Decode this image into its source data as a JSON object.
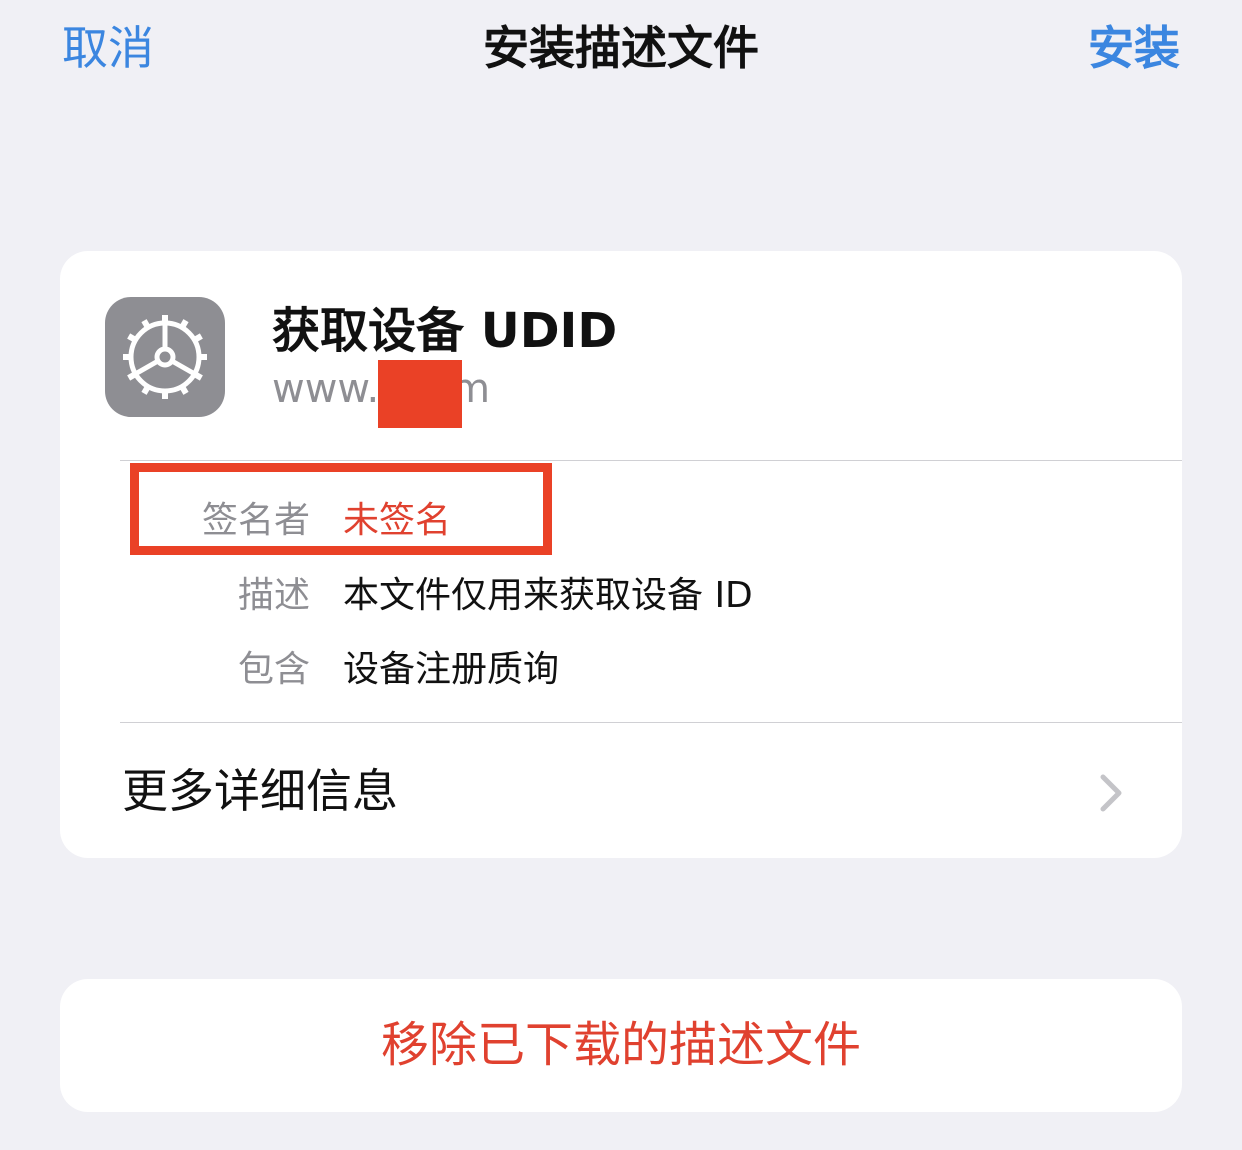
{
  "nav": {
    "cancel_label": "取消",
    "title": "安装描述文件",
    "install_label": "安装"
  },
  "profile": {
    "name": "获取设备 UDID",
    "domain": "www.      .com",
    "icon": "gear-icon"
  },
  "details": [
    {
      "label": "签名者",
      "value": "未签名"
    },
    {
      "label": "描述",
      "value": "本文件仅用来获取设备 ID"
    },
    {
      "label": "包含",
      "value": "设备注册质询"
    }
  ],
  "more_info_label": "更多详细信息",
  "remove_label": "移除已下载的描述文件",
  "colors": {
    "accent": "#3b86e0",
    "destructive": "#e0412f",
    "annotation": "#ea4126",
    "background": "#f0f0f5",
    "secondary_text": "#8e8e93"
  }
}
